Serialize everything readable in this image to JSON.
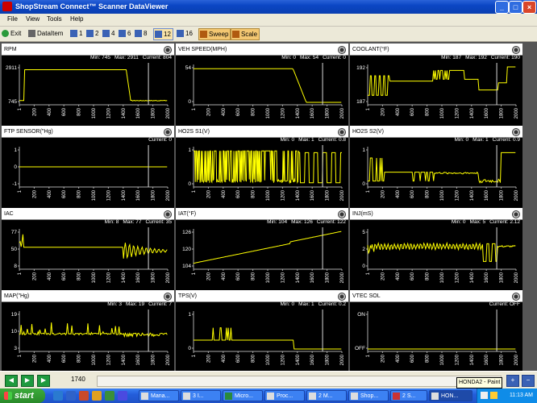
{
  "window": {
    "title": "ShopStream Connect™ Scanner DataViewer"
  },
  "menu": [
    "File",
    "View",
    "Tools",
    "Help"
  ],
  "toolbar": {
    "exit": "Exit",
    "dataitem": "DataItem",
    "layouts": [
      "1",
      "2",
      "4",
      "6",
      "8",
      "12",
      "16"
    ],
    "selected_layout": "12",
    "sweep": "Sweep",
    "scale": "Scale"
  },
  "panels": [
    {
      "name": "RPM",
      "min": "Min: 745",
      "max": "Max: 2911",
      "current": "Current: 804",
      "yticks": [
        "2911",
        "745"
      ],
      "series_color": "#ffff00"
    },
    {
      "name": "VEH SPEED(MPH)",
      "min": "Min: 0",
      "max": "Max: 54",
      "current": "Current: 0",
      "yticks": [
        "54",
        "0"
      ],
      "series_color": "#ffff00"
    },
    {
      "name": "COOLANT(°F)",
      "min": "Min: 187",
      "max": "Max: 192",
      "current": "Current: 190",
      "yticks": [
        "192",
        "187"
      ],
      "series_color": "#ffff00"
    },
    {
      "name": "FTP SENSOR(\"Hg)",
      "min": "",
      "max": "",
      "current": "Current: 0",
      "yticks": [
        "1",
        "0",
        "-1"
      ],
      "series_color": "#ffff00"
    },
    {
      "name": "HO2S S1(V)",
      "min": "Min: 0",
      "max": "Max: 1",
      "current": "Current: 0.8",
      "yticks": [
        "1",
        "0"
      ],
      "series_color": "#ffff00"
    },
    {
      "name": "HO2S S2(V)",
      "min": "Min: 0",
      "max": "Max: 1",
      "current": "Current: 0.9",
      "yticks": [
        "1",
        "0"
      ],
      "series_color": "#ffff00"
    },
    {
      "name": "IAC",
      "min": "Min: 8",
      "max": "Max: 77",
      "current": "Current: 35",
      "yticks": [
        "77",
        "50",
        "8"
      ],
      "series_color": "#ffff00"
    },
    {
      "name": "IAT(°F)",
      "min": "Min: 104",
      "max": "Max: 126",
      "current": "Current: 122",
      "yticks": [
        "126",
        "120",
        "104"
      ],
      "series_color": "#ffff00"
    },
    {
      "name": "INJ(mS)",
      "min": "Min: 0",
      "max": "Max: 5",
      "current": "Current: 2.12",
      "yticks": [
        "5",
        "2",
        "0"
      ],
      "series_color": "#ffff00"
    },
    {
      "name": "MAP(\"Hg)",
      "min": "Min: 3",
      "max": "Max: 19",
      "current": "Current: 7",
      "yticks": [
        "19",
        "10",
        "3"
      ],
      "series_color": "#ffff00"
    },
    {
      "name": "TPS(V)",
      "min": "Min: 0",
      "max": "Max: 1",
      "current": "Current: 0.2",
      "yticks": [
        "1",
        "0"
      ],
      "series_color": "#ffff00"
    },
    {
      "name": "VTEC SOL",
      "min": "",
      "max": "",
      "current": "Current: OFF",
      "yticks": [
        "ON",
        "OFF"
      ],
      "series_color": "#ffff00"
    }
  ],
  "xticks": [
    "1",
    "200",
    "400",
    "600",
    "800",
    "1000",
    "1200",
    "1400",
    "1600",
    "1800",
    "2000"
  ],
  "cursor_frame": 1740,
  "frame_label": "1740",
  "tooltip": "HONDA2 - Paint",
  "taskbar": {
    "start": "start",
    "tasks": [
      "Mana...",
      "3 I...",
      "Micro...",
      "Proc...",
      "2 M...",
      "Shop...",
      "2 S...",
      "HON..."
    ],
    "clock": "11:13 AM"
  }
}
